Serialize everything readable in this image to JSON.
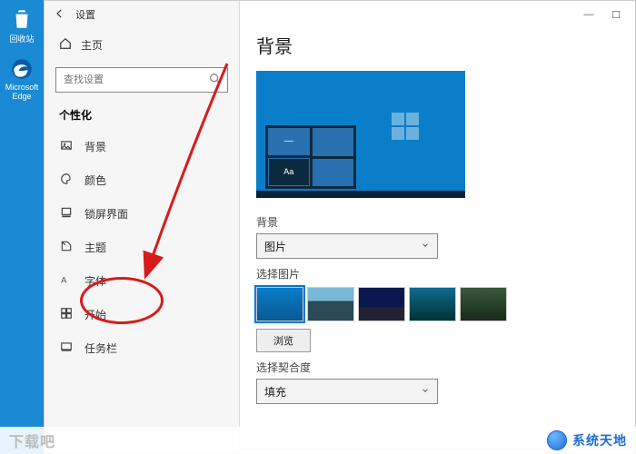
{
  "desktop": {
    "recycle_label": "回收站",
    "edge_label": "Microsoft Edge"
  },
  "titlebar": {
    "title": "设置",
    "min": "—",
    "max": "☐"
  },
  "sidebar": {
    "home_label": "主页",
    "search_placeholder": "查找设置",
    "section": "个性化",
    "items": [
      {
        "label": "背景"
      },
      {
        "label": "颜色"
      },
      {
        "label": "锁屏界面"
      },
      {
        "label": "主题"
      },
      {
        "label": "字体"
      },
      {
        "label": "开始"
      },
      {
        "label": "任务栏"
      }
    ]
  },
  "content": {
    "heading": "背景",
    "preview_sample": "Aa",
    "bg_label": "背景",
    "bg_select_value": "图片",
    "choose_label": "选择图片",
    "browse_label": "浏览",
    "fit_label": "选择契合度",
    "fit_select_value": "填充"
  },
  "watermark": {
    "left": "下载吧",
    "right": "系统天地"
  }
}
